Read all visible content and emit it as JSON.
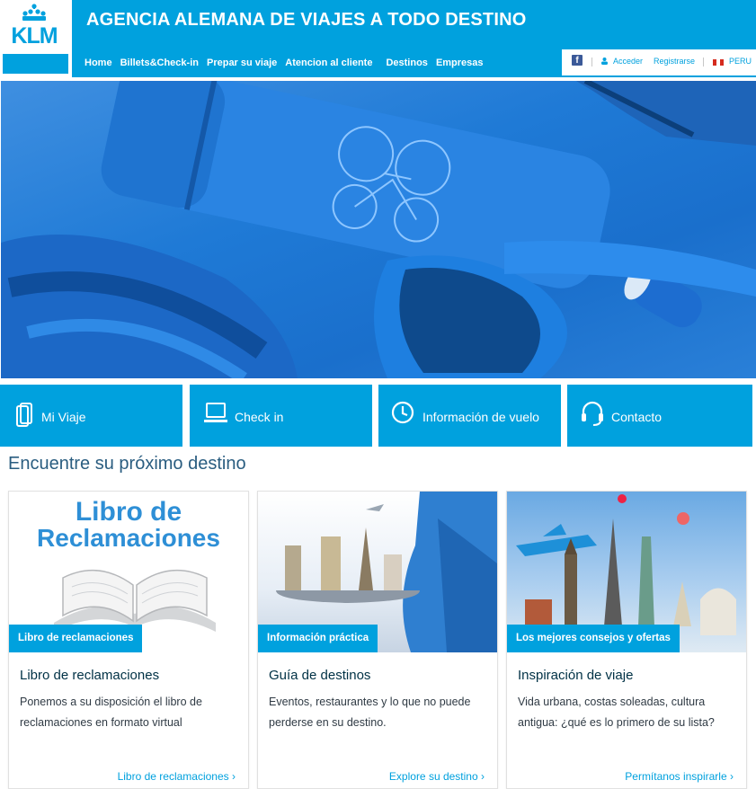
{
  "brand": {
    "logo_text": "KLM",
    "color": "#00a1de"
  },
  "header": {
    "title": "AGENCIA ALEMANA DE VIAJES A TODO DESTINO",
    "nav": [
      "Home",
      "Billets&Check-in",
      "Prepar su viaje",
      "Atencion al cliente",
      "Destinos",
      "Empresas"
    ]
  },
  "util": {
    "facebook_icon": "facebook-icon",
    "login": "Acceder",
    "register": "Registrarse",
    "country": "PERU"
  },
  "tiles": [
    {
      "label": "Mi Viaje",
      "icon": "phone-icon"
    },
    {
      "label": "Check in",
      "icon": "laptop-icon"
    },
    {
      "label": "Información de vuelo",
      "icon": "clock-icon"
    },
    {
      "label": "Contacto",
      "icon": "headset-icon"
    }
  ],
  "section": {
    "title": "Encuentre su próximo destino"
  },
  "cards": [
    {
      "image_heading_1": "Libro de",
      "image_heading_2": "Reclamaciones",
      "badge": "Libro de reclamaciones",
      "title": "Libro de reclamaciones",
      "desc": "Ponemos a su disposición el libro de reclamaciones en formato virtual",
      "link": "Libro de reclamaciones"
    },
    {
      "badge": "Información práctica",
      "title": "Guía de destinos",
      "desc": "Eventos, restaurantes y lo que no puede perderse en su destino.",
      "link": "Explore su destino"
    },
    {
      "badge": "Los mejores consejos y ofertas",
      "title": "Inspiración de viaje",
      "desc": "Vida urbana, costas soleadas, cultura antigua: ¿qué es lo primero de su lista?",
      "link": "Permítanos inspirarle"
    }
  ]
}
